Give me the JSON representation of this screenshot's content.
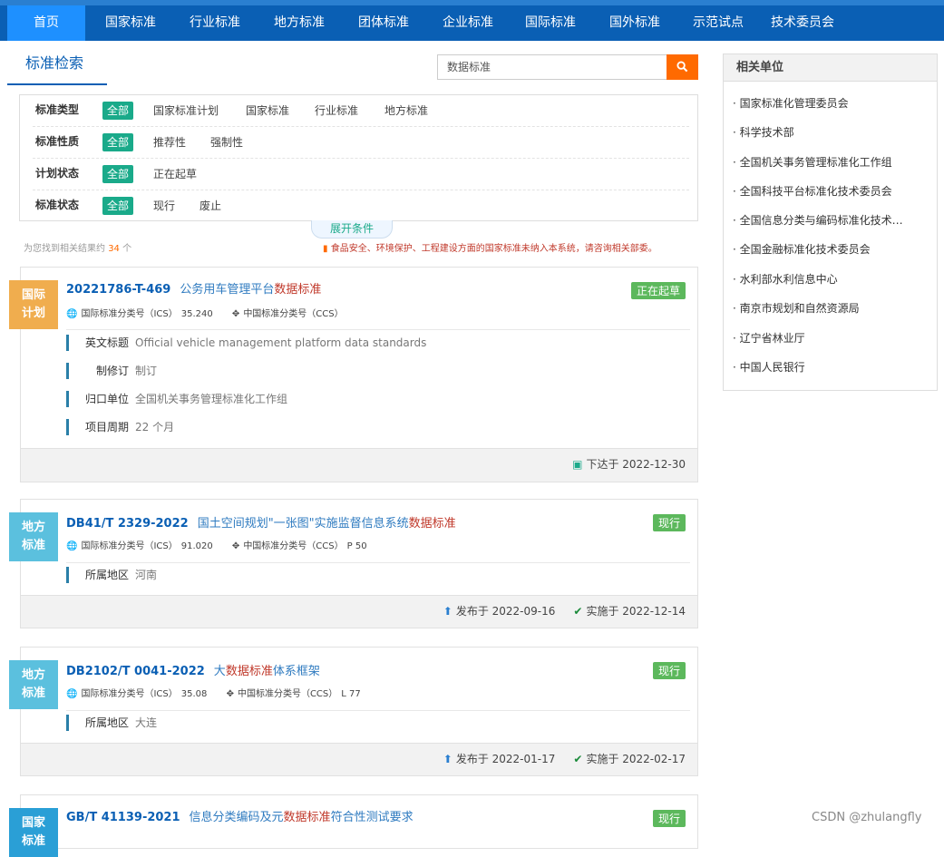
{
  "nav": [
    {
      "label": "首页",
      "active": true
    },
    {
      "label": "国家标准"
    },
    {
      "label": "行业标准"
    },
    {
      "label": "地方标准"
    },
    {
      "label": "团体标准"
    },
    {
      "label": "企业标准"
    },
    {
      "label": "国际标准"
    },
    {
      "label": "国外标准"
    },
    {
      "label": "示范试点"
    },
    {
      "label": "技术委员会"
    }
  ],
  "section_title": "标准检索",
  "search": {
    "value": "数据标准",
    "button_icon": "search-icon"
  },
  "filters": [
    {
      "label": "标准类型",
      "options": [
        "全部",
        "国家标准计划",
        "国家标准",
        "行业标准",
        "地方标准"
      ]
    },
    {
      "label": "标准性质",
      "options": [
        "全部",
        "推荐性",
        "强制性"
      ]
    },
    {
      "label": "计划状态",
      "options": [
        "全部",
        "正在起草"
      ]
    },
    {
      "label": "标准状态",
      "options": [
        "全部",
        "现行",
        "废止"
      ]
    }
  ],
  "expand_label": "展开条件",
  "result_count": {
    "prefix": "为您找到相关结果约",
    "num": "34",
    "suffix": "个"
  },
  "notice": "食品安全、环境保护、工程建设方面的国家标准未纳入本系统，请咨询相关部委。",
  "results": [
    {
      "tag": [
        "国际",
        "计划"
      ],
      "code": "20221786-T-469",
      "name_pre": "公务用车管理平台",
      "name_hl": "数据标准",
      "name_post": "",
      "status": "正在起草",
      "ics_label": "国际标准分类号（ICS）",
      "ics": "35.240",
      "ccs_label": "中国标准分类号（CCS）",
      "ccs": "",
      "details": [
        {
          "k": "英文标题",
          "v": "Official vehicle management platform data standards"
        },
        {
          "k": "制修订",
          "v": "制订"
        },
        {
          "k": "归口单位",
          "v": "全国机关事务管理标准化工作组"
        },
        {
          "k": "项目周期",
          "v": "22 个月"
        }
      ],
      "foot": "下达于 2022-12-30"
    },
    {
      "tag": [
        "地方",
        "标准"
      ],
      "code": "DB41/T 2329-2022",
      "name_pre": "国土空间规划\"一张图\"实施监督信息系统",
      "name_hl": "数据标准",
      "name_post": "",
      "status": "现行",
      "ics_label": "国际标准分类号（ICS）",
      "ics": "91.020",
      "ccs_label": "中国标准分类号（CCS）",
      "ccs": "P 50",
      "details": [
        {
          "k": "所属地区",
          "v": "河南"
        }
      ],
      "publish": "发布于 2022-09-16",
      "implement": "实施于 2022-12-14"
    },
    {
      "tag": [
        "地方",
        "标准"
      ],
      "code": "DB2102/T 0041-2022",
      "name_pre": "大",
      "name_hl": "数据标准",
      "name_post": "体系框架",
      "status": "现行",
      "ics_label": "国际标准分类号（ICS）",
      "ics": "35.08",
      "ccs_label": "中国标准分类号（CCS）",
      "ccs": "L 77",
      "details": [
        {
          "k": "所属地区",
          "v": "大连"
        }
      ],
      "publish": "发布于 2022-01-17",
      "implement": "实施于 2022-02-17"
    },
    {
      "tag": [
        "国家",
        "标准"
      ],
      "code": "GB/T 41139-2021",
      "name_pre": "信息分类编码及元",
      "name_hl": "数据标准",
      "name_post": "符合性测试要求",
      "status": "现行"
    }
  ],
  "sidebar": {
    "title": "相关单位",
    "items": [
      "国家标准化管理委员会",
      "科学技术部",
      "全国机关事务管理标准化工作组",
      "全国科技平台标准化技术委员会",
      "全国信息分类与编码标准化技术…",
      "全国金融标准化技术委员会",
      "水利部水利信息中心",
      "南京市规划和自然资源局",
      "辽宁省林业厅",
      "中国人民银行"
    ]
  },
  "watermark": "CSDN @zhulangfly",
  "colors": {
    "nav": "#0a5fb4",
    "accent": "#1aaa8a",
    "orange": "#ff6a00",
    "status": "#5cb85c"
  }
}
